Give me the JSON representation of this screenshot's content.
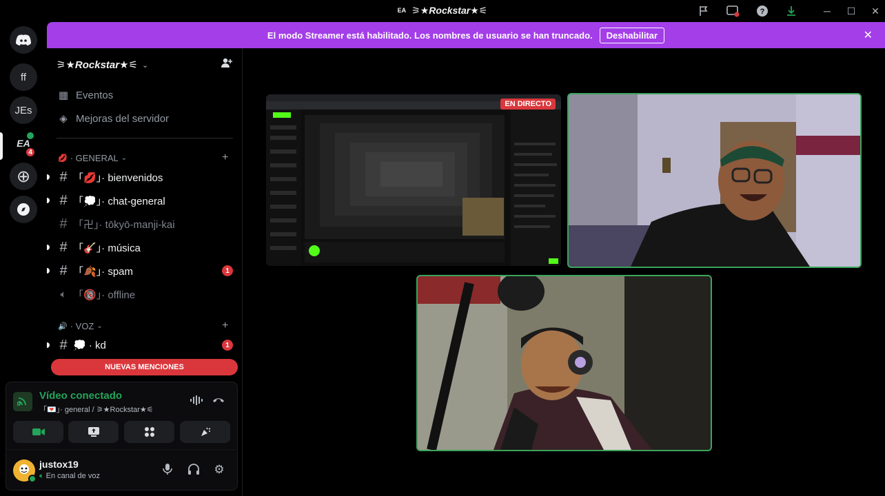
{
  "window": {
    "title": "⚞★Rockstar★⚟",
    "title_logo": "EA"
  },
  "titlebar_icons": [
    "inbox-flag-icon",
    "screen-share-icon",
    "help-icon",
    "download-icon"
  ],
  "window_controls": [
    "minimize-icon",
    "maximize-icon",
    "close-icon"
  ],
  "rail": {
    "items": [
      {
        "label": "ff"
      },
      {
        "label": "JEs"
      },
      {
        "label": "EA",
        "badge": "4"
      }
    ]
  },
  "banner": {
    "text": "El modo Streamer está habilitado. Los nombres de usuario se han truncado.",
    "button": "Deshabilitar",
    "accent": "#a33ee8"
  },
  "server": {
    "name": "⚞★Rockstar★⚟",
    "nav": [
      {
        "label": "Eventos"
      },
      {
        "label": "Mejoras del servidor"
      }
    ]
  },
  "categories": [
    {
      "label": "· GENERAL",
      "emoji": "💋"
    },
    {
      "label": "· VOZ",
      "emoji": "🔊"
    }
  ],
  "channels": [
    {
      "name": "「💋」· bienvenidos"
    },
    {
      "name": "「💭」· chat-general"
    },
    {
      "name": "「卍」· tōkyō-manji-kai"
    },
    {
      "name": "「🎸」· música"
    },
    {
      "name": "「🍂」· spam",
      "badge": "1"
    },
    {
      "name": "「🔞」· offline"
    },
    {
      "name": "💭 · kd",
      "badge": "1"
    }
  ],
  "mentions_bar": "NUEVAS MENCIONES",
  "voice": {
    "status": "Vídeo conectado",
    "location": "「💌」· general / ⚞★Rockstar★⚟"
  },
  "user": {
    "name": "justox19",
    "status": "En canal de voz"
  },
  "stream": {
    "live_label": "EN DIRECTO"
  },
  "colors": {
    "green": "#23a55a",
    "red": "#da373c",
    "speaking_border": "#3ba55c"
  }
}
